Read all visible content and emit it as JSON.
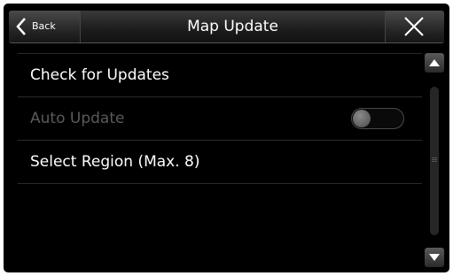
{
  "header": {
    "back_label": "Back",
    "title": "Map Update"
  },
  "items": [
    {
      "label": "Check for Updates",
      "enabled": true
    },
    {
      "label": "Auto Update",
      "enabled": false,
      "toggle": "off"
    },
    {
      "label": "Select Region (Max. 8)",
      "enabled": true
    }
  ],
  "icons": {
    "back": "chevron-left-icon",
    "close": "close-icon",
    "scroll_up": "triangle-up-icon",
    "scroll_down": "triangle-down-icon"
  },
  "colors": {
    "background": "#000000",
    "text": "#ffffff",
    "disabled_text": "#5a5a5a"
  }
}
